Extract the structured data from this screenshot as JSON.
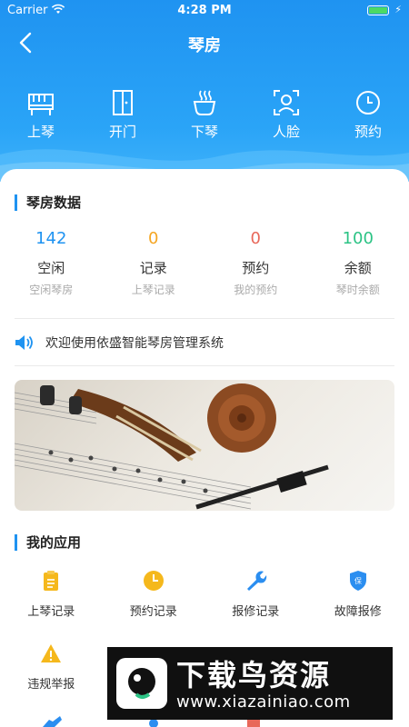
{
  "status_bar": {
    "carrier": "Carrier",
    "time": "4:28 PM",
    "battery_level": 1.0
  },
  "nav": {
    "title": "琴房"
  },
  "quick_actions": [
    {
      "label": "上琴",
      "icon": "piano-icon"
    },
    {
      "label": "开门",
      "icon": "door-icon"
    },
    {
      "label": "下琴",
      "icon": "cup-icon"
    },
    {
      "label": "人脸",
      "icon": "face-icon"
    },
    {
      "label": "预约",
      "icon": "clock-icon"
    }
  ],
  "stats_section": {
    "title": "琴房数据",
    "items": [
      {
        "value": "142",
        "name": "空闲",
        "sub": "空闲琴房",
        "color": "#1f93f1"
      },
      {
        "value": "0",
        "name": "记录",
        "sub": "上琴记录",
        "color": "#f5a623"
      },
      {
        "value": "0",
        "name": "预约",
        "sub": "我的预约",
        "color": "#e8685a"
      },
      {
        "value": "100",
        "name": "余额",
        "sub": "琴时余额",
        "color": "#2cc385"
      }
    ]
  },
  "notice": {
    "text": "欢迎使用依盛智能琴房管理系统"
  },
  "apps_section": {
    "title": "我的应用",
    "items": [
      {
        "label": "上琴记录",
        "icon": "clipboard-icon"
      },
      {
        "label": "预约记录",
        "icon": "clock-icon"
      },
      {
        "label": "报修记录",
        "icon": "wrench-icon"
      },
      {
        "label": "故障报修",
        "icon": "shield-icon"
      },
      {
        "label": "违规举报",
        "icon": "warning-icon"
      }
    ]
  },
  "watermark": {
    "title": "下载鸟资源",
    "url": "www.xiazainiao.com"
  },
  "colors": {
    "primary": "#1f93f1",
    "accent_yellow": "#f5b81c"
  }
}
